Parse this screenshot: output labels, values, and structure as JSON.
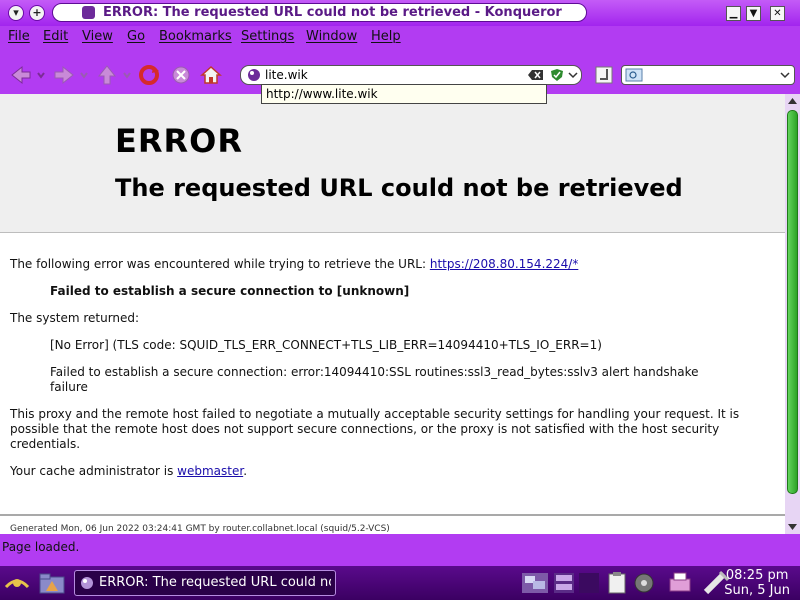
{
  "window": {
    "title": "ERROR: The requested URL could not be retrieved - Konqueror"
  },
  "menubar": {
    "items": [
      "File",
      "Edit",
      "View",
      "Go",
      "Bookmarks",
      "Settings",
      "Window",
      "Help"
    ]
  },
  "toolbar": {
    "url_value": "lite.wik",
    "autocomplete": "http://www.lite.wik",
    "search_value": ""
  },
  "page": {
    "h1": "ERROR",
    "h2": "The requested URL could not be retrieved",
    "p1_prefix": "The following error was encountered while trying to retrieve the URL: ",
    "p1_link": "https://208.80.154.224/*",
    "error_strong": "Failed to establish a secure connection to [unknown]",
    "system_returned": "The system returned:",
    "sys_error": "[No Error] (TLS code: SQUID_TLS_ERR_CONNECT+TLS_LIB_ERR=14094410+TLS_IO_ERR=1)",
    "sys_detail": "Failed to establish a secure connection: error:14094410:SSL routines:ssl3_read_bytes:sslv3 alert handshake failure",
    "explanation": "This proxy and the remote host failed to negotiate a mutually acceptable security settings for handling your request. It is possible that the remote host does not support secure connections, or the proxy is not satisfied with the host security credentials.",
    "admin_prefix": "Your cache administrator is ",
    "admin_link": "webmaster",
    "admin_suffix": ".",
    "footer": "Generated Mon, 06 Jun 2022 03:24:41 GMT by router.collabnet.local (squid/5.2-VCS)"
  },
  "status": {
    "text": "Page loaded."
  },
  "taskbar": {
    "task_label": "ERROR: The requested URL could not be retrieved - Konqueror",
    "time": "08:25 pm",
    "date": "Sun, 5 Jun"
  },
  "colors": {
    "accent": "#b23cf2",
    "scroll_thumb": "#3fbf38"
  }
}
